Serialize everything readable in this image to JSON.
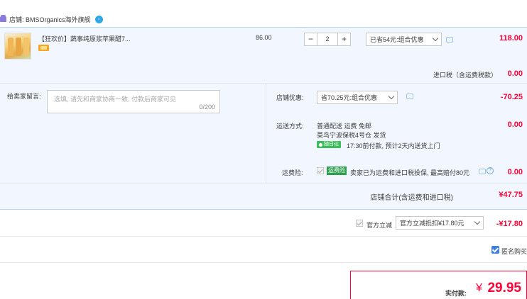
{
  "store": {
    "label": "店铺: BMSOrganics海外旗舰",
    "shop_icon": "shop-icon",
    "contact_icon": "wangwang-icon"
  },
  "item": {
    "title": "【狂欢价】蔬事纯原浆苹果醋7...",
    "unit_price": "86.00",
    "quantity": "2",
    "minus_label": "−",
    "plus_label": "+",
    "promo_select": "已省54元:组合优惠",
    "total": "118.00"
  },
  "tax": {
    "label": "进口税（含运费税款）",
    "value": "0.00"
  },
  "seller_message": {
    "label": "给卖家留言:",
    "placeholder": "选填, 请先和商家协商一致, 付款后商家可见",
    "count": "0/200"
  },
  "shop_discount": {
    "label": "店铺优惠:",
    "select": "省70.25元:组合优惠",
    "value": "-70.25"
  },
  "shipping": {
    "label": "运送方式:",
    "line1": "普通配送 运费 免邮",
    "line2": "菜鸟宁波保税4号仓  发货",
    "tag": "随日达",
    "line3": "17:30前付款, 预计2天内送货上门",
    "value": "0.00"
  },
  "insurance": {
    "label": "运费险:",
    "badge": "运费险",
    "text": "卖家已为运费和进口税投保, 最高赔付80元",
    "help": "?",
    "value": "0.00"
  },
  "store_total": {
    "label": "店铺合计(含运费和进口税)",
    "value": "¥47.75"
  },
  "official_discount": {
    "label": "官方立减",
    "select": "官方立减抵扣¥17.80元",
    "value": "-¥17.80"
  },
  "anonymous": {
    "label": "匿名购买",
    "checked": true
  },
  "payment": {
    "label": "实付款:",
    "currency": "¥",
    "value": "29.95"
  },
  "colors": {
    "accent_red": "#ff0036",
    "panel_bg": "#f2f7ff",
    "panel_border": "#b8d4f5",
    "checkbox_blue": "#3e7fe0"
  }
}
